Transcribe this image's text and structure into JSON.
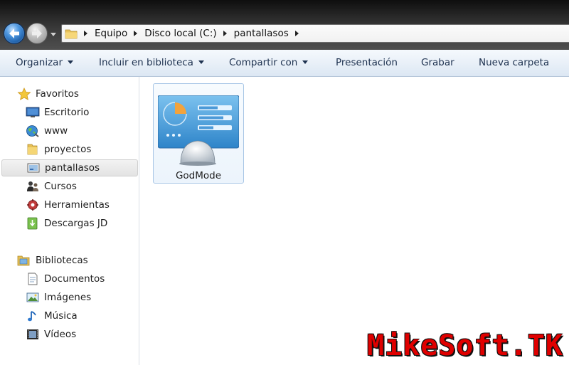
{
  "breadcrumb": [
    "Equipo",
    "Disco local (C:)",
    "pantallasos"
  ],
  "toolbar": {
    "organize": "Organizar",
    "include_library": "Incluir en biblioteca",
    "share_with": "Compartir con",
    "slideshow": "Presentación",
    "burn": "Grabar",
    "new_folder": "Nueva carpeta"
  },
  "favorites": {
    "header": "Favoritos",
    "items": [
      "Escritorio",
      "www",
      "proyectos",
      "pantallasos",
      "Cursos",
      "Herramientas",
      "Descargas JD"
    ],
    "selected": "pantallasos"
  },
  "libraries": {
    "header": "Bibliotecas",
    "items": [
      "Documentos",
      "Imágenes",
      "Música",
      "Vídeos"
    ]
  },
  "content": {
    "items": [
      {
        "name": "GodMode",
        "icon": "control-panel-icon"
      }
    ]
  },
  "watermark": "MikeSoft.TK",
  "colors": {
    "accent": "#3b87d8",
    "selection_border": "#a8c6e6",
    "watermark": "#e00000"
  }
}
